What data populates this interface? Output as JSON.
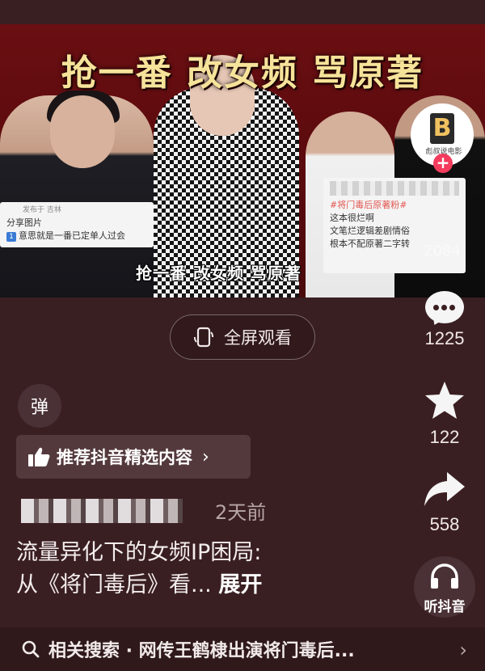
{
  "video": {
    "banner_title": "抢一番  改女频  骂原著",
    "subtitle": "抢一番  改女频  骂原著",
    "card_left": {
      "meta": "发布于 吉林",
      "share": "分享图片",
      "number": "1",
      "text": "意思就是一番已定单人过会"
    },
    "card_right": {
      "tag": "#将门毒后原著粉#",
      "lines": [
        "这本很烂啊",
        "文笔烂逻辑差剧情俗",
        "根本不配原著二字转"
      ]
    },
    "faded_count": "2084"
  },
  "creator": {
    "logo_letter": "B",
    "logo_text": "彪叔说电影",
    "follow_icon": "plus-icon"
  },
  "actions": {
    "comments": "1225",
    "favorites": "122",
    "shares": "558",
    "listen_label": "听抖音"
  },
  "fullscreen_label": "全屏观看",
  "danmu_label": "弹",
  "recommend_label": "推荐抖音精选内容",
  "post_time": "2天前",
  "caption": {
    "text": "流量异化下的女频IP困局:从《将门毒后》看...",
    "line1": "流量异化下的女频IP困局:",
    "line2": "从《将门毒后》看...",
    "expand": "展开"
  },
  "related_search": "相关搜索 · 网传王鹤棣出演将门毒后...",
  "colors": {
    "background": "#3a1f22",
    "follow": "#f43c5d",
    "banner_text": "#f6e39a"
  }
}
